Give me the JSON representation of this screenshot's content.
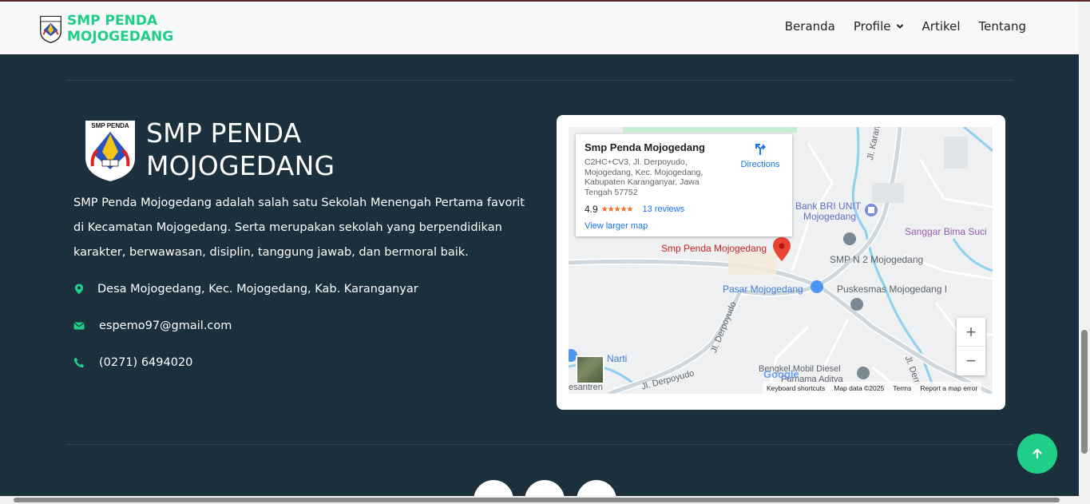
{
  "navbar": {
    "brand_line1": "SMP PENDA",
    "brand_line2": "MOJOGEDANG",
    "links": [
      {
        "label": "Beranda"
      },
      {
        "label": "Profile"
      },
      {
        "label": "Artikel"
      },
      {
        "label": "Tentang"
      }
    ]
  },
  "footer": {
    "title_line1": "SMP PENDA",
    "title_line2": "MOJOGEDANG",
    "logo_text": "SMP PENDA",
    "description": "SMP Penda Mojogedang adalah salah satu Sekolah Menengah Pertama favorit di Kecamatan Mojogedang. Serta merupakan sekolah yang berpendidikan karakter, berwawasan, disiplin, tanggung jawab, dan bermoral baik.",
    "address": "Desa Mojogedang, Kec. Mojogedang, Kab. Karanganyar",
    "email": "espemo97@gmail.com",
    "phone": "(0271) 6494020"
  },
  "map": {
    "place_name": "Smp Penda Mojogedang",
    "address": "C2HC+CV3, Jl. Derpoyudo, Mojogedang, Kec. Mojogedang, Kabupaten Karanganyar, Jawa Tengah 57752",
    "directions_label": "Directions",
    "rating": "4.9",
    "stars": "★★★★★",
    "reviews": "13 reviews",
    "larger_map": "View larger map",
    "labels": {
      "pin": "Smp Penda Mojogedang",
      "bank": "Bank BRI UNIT",
      "bank2": "Mojogedang",
      "sanggar": "Sanggar Bima Suci",
      "smpn2": "SMP N 2 Mojogedang",
      "pasar": "Pasar Mojogedang",
      "puskesmas": "Puskesmas Mojogedang I",
      "jl_karanganyar": "Jl. Karanganya",
      "jl_derpoyudo1": "Jl. Derpoyudo",
      "jl_derpoyudo2": "Jl. Derpoyudo",
      "jl_derp3": "Jl. Derp",
      "bengkel": "Bengkel Mobil Diesel",
      "bengkel2": "Purnama Aditya",
      "narti": "Narti",
      "pesantren": "esantren",
      "google": "Google"
    },
    "zoom_in": "+",
    "zoom_out": "−",
    "attribution": [
      "Keyboard shortcuts",
      "Map data ©2025",
      "Terms",
      "Report a map error"
    ]
  },
  "colors": {
    "accent": "#1fcf87",
    "footer_bg": "#1b2f3c",
    "pin": "#ea4335"
  }
}
